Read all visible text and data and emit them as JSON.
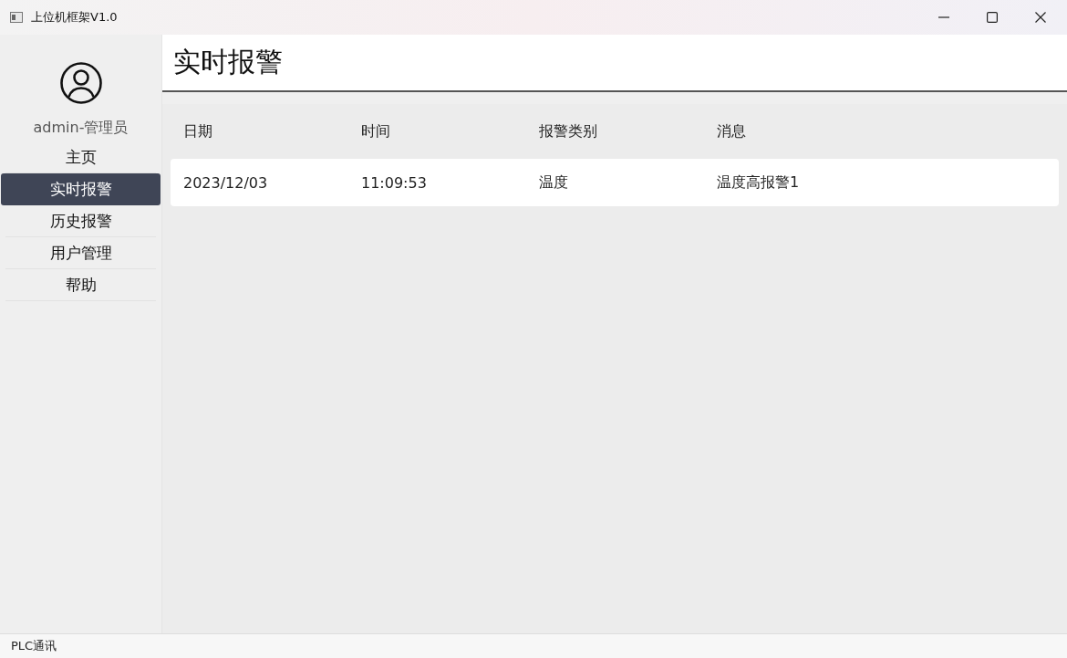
{
  "window": {
    "title": "上位机框架V1.0"
  },
  "sidebar": {
    "user": "admin-管理员",
    "items": [
      {
        "label": "主页",
        "selected": false
      },
      {
        "label": "实时报警",
        "selected": true
      },
      {
        "label": "历史报警",
        "selected": false
      },
      {
        "label": "用户管理",
        "selected": false
      },
      {
        "label": "帮助",
        "selected": false
      }
    ]
  },
  "page": {
    "title": "实时报警"
  },
  "table": {
    "columns": [
      "日期",
      "时间",
      "报警类别",
      "消息"
    ],
    "rows": [
      [
        "2023/12/03",
        "11:09:53",
        "温度",
        "温度高报警1"
      ]
    ]
  },
  "status_bar": {
    "text": "PLC通讯"
  }
}
